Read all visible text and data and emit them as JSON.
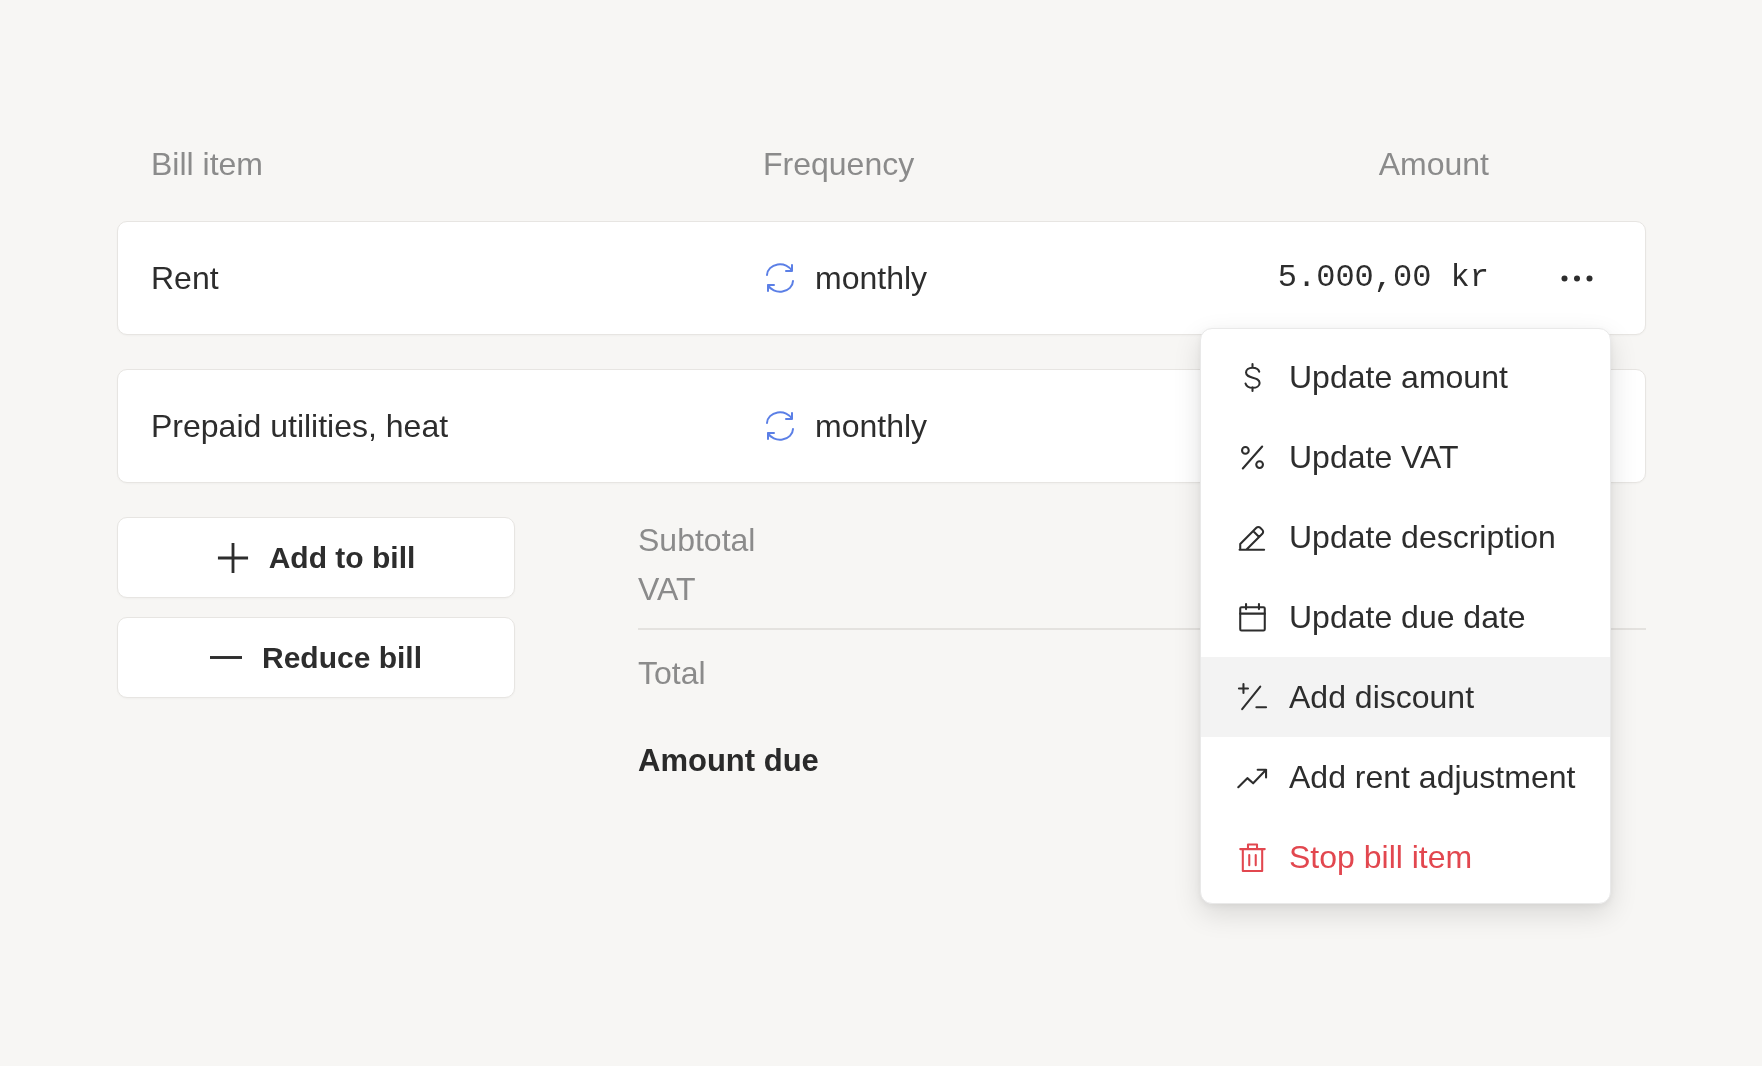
{
  "table": {
    "columns": [
      "Bill item",
      "Frequency",
      "Amount"
    ],
    "rows": [
      {
        "name": "Rent",
        "frequency": "monthly",
        "amount": "5.000,00 kr"
      },
      {
        "name": "Prepaid utilities, heat",
        "frequency": "monthly"
      }
    ]
  },
  "actions": [
    {
      "kind": "add",
      "label": "Add to bill"
    },
    {
      "kind": "reduce",
      "label": "Reduce bill"
    }
  ],
  "totals": {
    "subtotal": "Subtotal",
    "vat": "VAT",
    "total": "Total",
    "amount_due": "Amount due"
  },
  "row_menu": {
    "items": [
      {
        "kind": "amount",
        "label": "Update amount",
        "highlighted": false,
        "danger": false
      },
      {
        "kind": "vat",
        "label": "Update VAT",
        "highlighted": false,
        "danger": false
      },
      {
        "kind": "description",
        "label": "Update description",
        "highlighted": false,
        "danger": false
      },
      {
        "kind": "due-date",
        "label": "Update due date",
        "highlighted": false,
        "danger": false
      },
      {
        "kind": "discount",
        "label": "Add discount",
        "highlighted": true,
        "danger": false
      },
      {
        "kind": "adjustment",
        "label": "Add rent adjustment",
        "highlighted": false,
        "danger": false
      },
      {
        "kind": "stop",
        "label": "Stop bill item",
        "highlighted": false,
        "danger": true
      }
    ]
  }
}
